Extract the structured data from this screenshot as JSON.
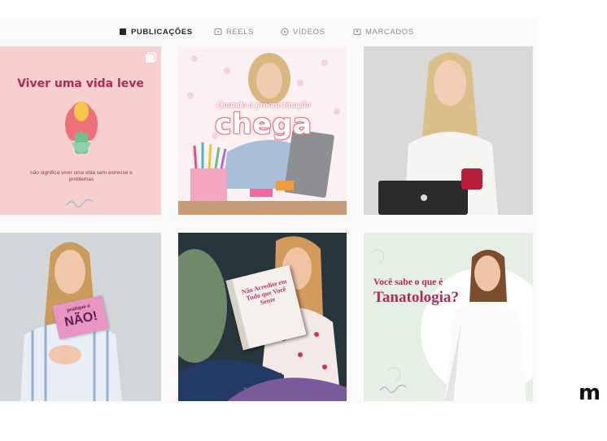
{
  "tabs": [
    {
      "label": "PUBLICAÇÕES",
      "icon": "grid-icon",
      "active": true
    },
    {
      "label": "REELS",
      "icon": "reels-icon",
      "active": false
    },
    {
      "label": "VÍDEOS",
      "icon": "play-icon",
      "active": false
    },
    {
      "label": "MARCADOS",
      "icon": "tag-icon",
      "active": false
    }
  ],
  "posts": [
    {
      "title": "Viver uma vida leve",
      "subtitle": "não significa viver uma vida sem estresse e problemas",
      "background": "#f8cfcf"
    },
    {
      "title_small": "Quando a procrastinação",
      "title_big": "chega",
      "background": "#fbf0f2"
    },
    {
      "background": "#d9d9d7"
    },
    {
      "card_small": "pratique o",
      "card_big": "NÃO!",
      "background": "#d3d6d9"
    },
    {
      "book_text": "Não Acredite em Tudo que Você Sente",
      "background": "#2b3a3f"
    },
    {
      "question": "Você sabe o que é",
      "question_big": "Tanatologia?",
      "background": "#e6efe3"
    }
  ],
  "corner_logo": "m",
  "colors": {
    "accent": "#b02a58",
    "pink": "#e8788c",
    "tab_active": "#262626",
    "tab_inactive": "#8e8e8e"
  }
}
